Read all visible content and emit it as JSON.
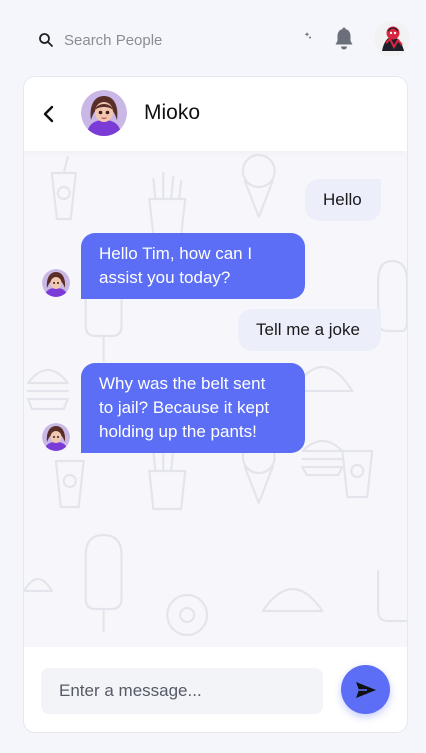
{
  "search": {
    "placeholder": "Search People"
  },
  "header_icons": [
    "moon-icon",
    "bell-icon",
    "user-avatar"
  ],
  "chat": {
    "contact_name": "Mioko",
    "messages": [
      {
        "from": "user",
        "text": "Hello"
      },
      {
        "from": "bot",
        "text_lines": [
          "Hello Tim, how can I",
          "assist you today?"
        ]
      },
      {
        "from": "user",
        "text": "Tell me a joke"
      },
      {
        "from": "bot",
        "text_lines": [
          "Why was the belt sent",
          "to jail? Because it kept",
          "holding up the pants!"
        ]
      }
    ]
  },
  "composer": {
    "placeholder": "Enter a message..."
  },
  "colors": {
    "accent": "#5b6ef5",
    "outgoing_bubble": "#eceefa",
    "page_bg": "#f5f6fb",
    "icon_gray": "#6b6f7a"
  }
}
